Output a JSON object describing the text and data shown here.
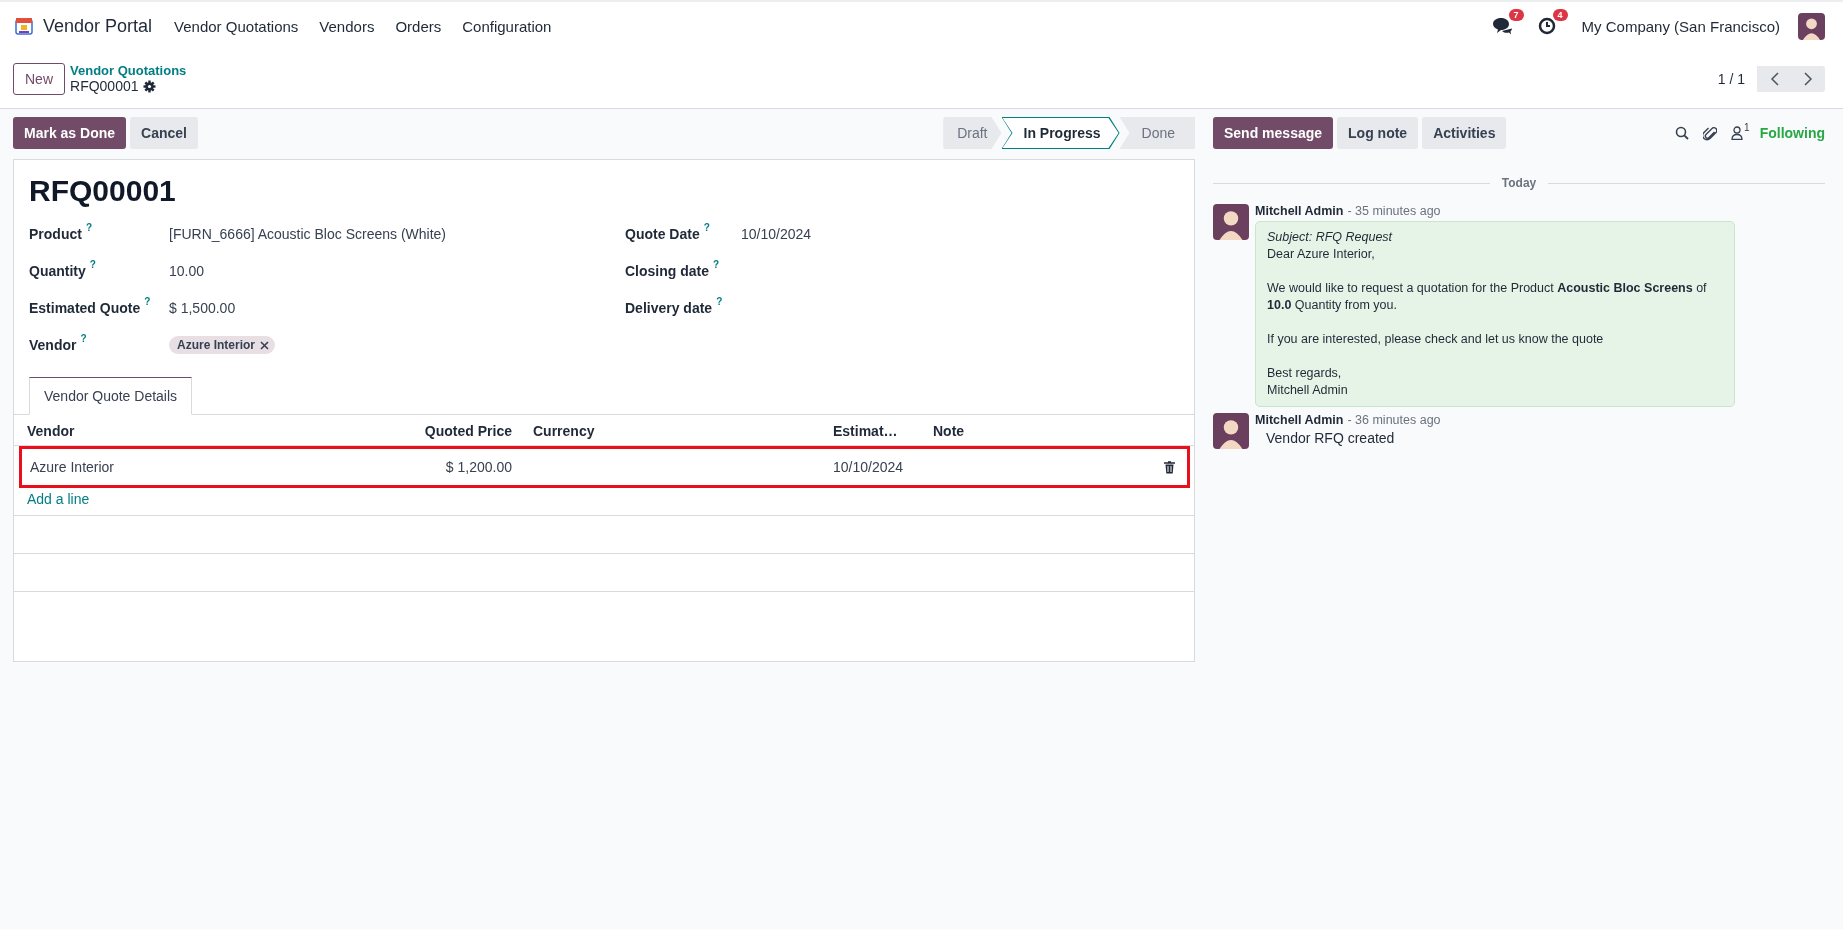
{
  "navbar": {
    "app_name": "Vendor Portal",
    "menu": [
      "Vendor Quotations",
      "Vendors",
      "Orders",
      "Configuration"
    ],
    "messages_badge": "7",
    "activities_badge": "4",
    "company": "My Company (San Francisco)"
  },
  "control_panel": {
    "new_button": "New",
    "breadcrumb": "Vendor Quotations",
    "record": "RFQ00001",
    "pager": "1 / 1"
  },
  "actions": [
    {
      "label": "Mark as Done",
      "kind": "primary"
    },
    {
      "label": "Cancel",
      "kind": "secondary"
    }
  ],
  "statusbar": [
    {
      "label": "Draft",
      "selected": false
    },
    {
      "label": "In Progress",
      "selected": true
    },
    {
      "label": "Done",
      "selected": false
    }
  ],
  "form": {
    "title": "RFQ00001",
    "left_fields": [
      {
        "label": "Product",
        "help": "?",
        "kind": "text",
        "value": "[FURN_6666] Acoustic Bloc Screens (White)"
      },
      {
        "label": "Quantity",
        "help": "?",
        "kind": "text",
        "value": "10.00"
      },
      {
        "label": "Estimated Quote",
        "help": "?",
        "kind": "text",
        "value": "$ 1,500.00"
      },
      {
        "label": "Vendor",
        "help": "?",
        "kind": "tag",
        "value": "Azure Interior"
      }
    ],
    "right_fields": [
      {
        "label": "Quote Date",
        "help": "?",
        "kind": "text",
        "value": "10/10/2024"
      },
      {
        "label": "Closing date",
        "help": "?",
        "kind": "empty"
      },
      {
        "label": "Delivery date",
        "help": "?",
        "kind": "empty"
      }
    ],
    "tabs": [
      {
        "label": "Vendor Quote Details",
        "selected": true
      }
    ],
    "table": {
      "columns": [
        "Vendor",
        "Quoted Price",
        "Currency",
        "Estimat…",
        "Note"
      ],
      "rows": [
        {
          "vendor": "Azure Interior",
          "quoted_price": "$ 1,200.00",
          "estimated": "10/10/2024",
          "highlighted": true
        }
      ],
      "add_line": "Add a line"
    }
  },
  "chatter": {
    "buttons": [
      {
        "label": "Send message",
        "kind": "primary"
      },
      {
        "label": "Log note",
        "kind": "secondary"
      },
      {
        "label": "Activities",
        "kind": "secondary"
      }
    ],
    "followers_count": "1",
    "follow_label": "Following",
    "date_separator": "Today",
    "messages": [
      {
        "kind": "email",
        "author": "Mitchell Admin",
        "time": "- 35 minutes ago",
        "subject": "Subject: RFQ Request",
        "paragraphs": [
          [
            "Dear Azure Interior,"
          ],
          [
            "We would like to request a quotation for the Product **Acoustic Bloc Screens** of **10.0** Quantity from you."
          ],
          [
            "If you are interested, please check and let us know the quote"
          ],
          [
            "Best regards,",
            "Mitchell Admin"
          ]
        ]
      },
      {
        "kind": "note",
        "author": "Mitchell Admin",
        "time": "- 36 minutes ago",
        "body": "Vendor RFQ created"
      }
    ]
  }
}
